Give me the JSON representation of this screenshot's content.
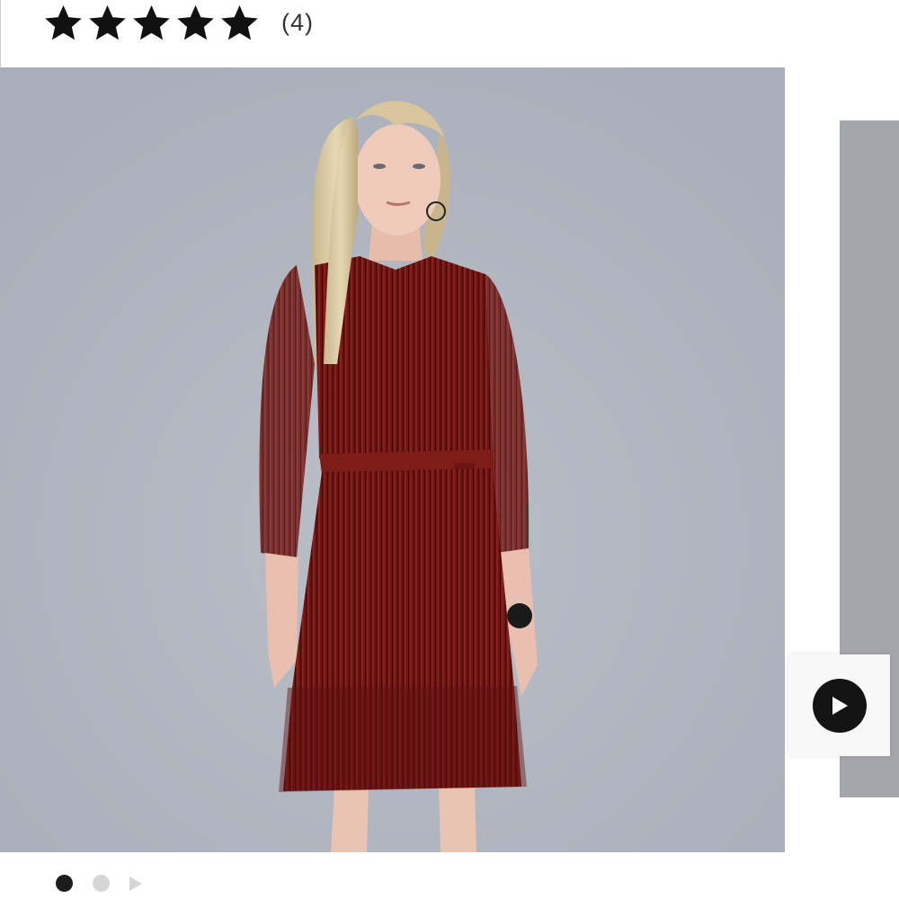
{
  "rating": {
    "stars": 5,
    "max_stars": 5,
    "review_count": "(4)",
    "star_color": "#111111"
  },
  "gallery": {
    "main_image_icon": "product-photo-red-pleated-belted-dress",
    "next_image_icon": "product-photo-preview",
    "video_button_icon": "play-icon",
    "current_slide": 1,
    "slides": 2,
    "background_color": "#b1b6c0",
    "dress_color": "#6e1614",
    "active_dot_color": "#1c1c1c",
    "inactive_dot_color": "#d6d6d6"
  }
}
